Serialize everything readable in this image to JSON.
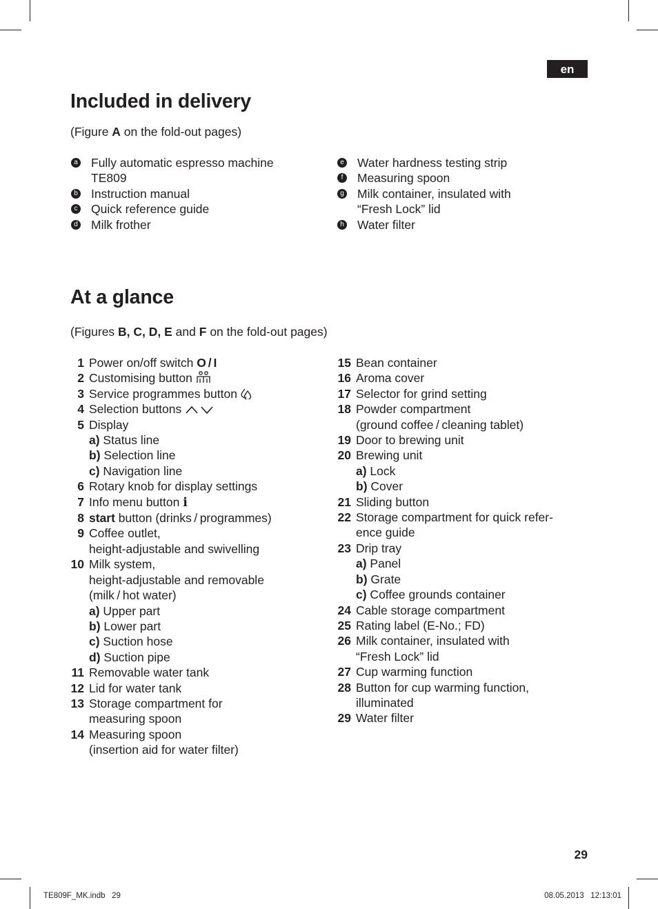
{
  "language_tab": "en",
  "sections": {
    "delivery": {
      "title": "Included in delivery",
      "subtitle_pre": "(Figure ",
      "subtitle_bold": "A",
      "subtitle_post": " on the fold-out pages)",
      "items_left": [
        {
          "marker": "a",
          "lines": [
            "Fully automatic espresso machine",
            "TE809"
          ]
        },
        {
          "marker": "b",
          "lines": [
            "Instruction manual"
          ]
        },
        {
          "marker": "c",
          "lines": [
            "Quick reference guide"
          ]
        },
        {
          "marker": "d",
          "lines": [
            "Milk frother"
          ]
        }
      ],
      "items_right": [
        {
          "marker": "e",
          "lines": [
            "Water hardness testing strip"
          ]
        },
        {
          "marker": "f",
          "lines": [
            "Measuring spoon"
          ]
        },
        {
          "marker": "g",
          "lines": [
            "Milk container, insulated with",
            "“Fresh Lock” lid"
          ]
        },
        {
          "marker": "h",
          "lines": [
            "Water filter"
          ]
        }
      ]
    },
    "glance": {
      "title": "At a glance",
      "subtitle_pre": "(Figures ",
      "subtitle_bold1": "B, C, D, E",
      "subtitle_mid": " and ",
      "subtitle_bold2": "F",
      "subtitle_post": " on the fold-out pages)",
      "items_left": [
        {
          "num": "1",
          "text": "Power on/off switch ",
          "icon": "power-switch-icon",
          "icon_text": "O / I"
        },
        {
          "num": "2",
          "text": "Customising button ",
          "icon": "customising-people-icon"
        },
        {
          "num": "3",
          "text": "Service programmes button ",
          "icon": "service-drops-icon"
        },
        {
          "num": "4",
          "text": "Selection buttons ",
          "icon": "up-down-chevrons-icon"
        },
        {
          "num": "5",
          "text": "Display",
          "subs": [
            {
              "label": "a)",
              "text": " Status line"
            },
            {
              "label": "b)",
              "text": " Selection line"
            },
            {
              "label": "c)",
              "text": " Navigation line"
            }
          ]
        },
        {
          "num": "6",
          "text": "Rotary knob for display settings"
        },
        {
          "num": "7",
          "text": "Info menu button ",
          "icon": "info-icon",
          "icon_text": "i"
        },
        {
          "num": "8",
          "bold_lead": "start",
          "text": " button (drinks / programmes)"
        },
        {
          "num": "9",
          "lines": [
            "Coffee outlet,",
            "height-adjustable and swivelling"
          ]
        },
        {
          "num": "10",
          "lines": [
            "Milk system,",
            "height-adjustable and removable",
            "(milk / hot water)"
          ],
          "subs": [
            {
              "label": "a)",
              "text": " Upper part"
            },
            {
              "label": "b)",
              "text": " Lower part"
            },
            {
              "label": "c)",
              "text": " Suction hose"
            },
            {
              "label": "d)",
              "text": " Suction pipe"
            }
          ]
        },
        {
          "num": "11",
          "text": "Removable water tank"
        },
        {
          "num": "12",
          "text": "Lid for water tank"
        },
        {
          "num": "13",
          "lines": [
            "Storage compartment for",
            "measuring spoon"
          ]
        },
        {
          "num": "14",
          "lines": [
            "Measuring spoon",
            "(insertion aid for water filter)"
          ]
        }
      ],
      "items_right": [
        {
          "num": "15",
          "text": "Bean container"
        },
        {
          "num": "16",
          "text": "Aroma cover"
        },
        {
          "num": "17",
          "text": "Selector for grind setting"
        },
        {
          "num": "18",
          "lines": [
            "Powder compartment",
            "(ground coffee / cleaning tablet)"
          ]
        },
        {
          "num": "19",
          "text": "Door to brewing unit"
        },
        {
          "num": "20",
          "text": "Brewing unit",
          "subs": [
            {
              "label": "a)",
              "text": " Lock"
            },
            {
              "label": "b)",
              "text": " Cover"
            }
          ]
        },
        {
          "num": "21",
          "text": "Sliding button"
        },
        {
          "num": "22",
          "lines": [
            "Storage compartment for quick refer-",
            "ence guide"
          ]
        },
        {
          "num": "23",
          "text": "Drip tray",
          "subs": [
            {
              "label": "a)",
              "text": " Panel"
            },
            {
              "label": "b)",
              "text": " Grate"
            },
            {
              "label": "c)",
              "text": " Coffee grounds container"
            }
          ]
        },
        {
          "num": "24",
          "text": "Cable storage compartment"
        },
        {
          "num": "25",
          "text": "Rating label (E-No.; FD)"
        },
        {
          "num": "26",
          "lines": [
            "Milk container, insulated with",
            "“Fresh Lock” lid"
          ]
        },
        {
          "num": "27",
          "text": "Cup warming function"
        },
        {
          "num": "28",
          "lines": [
            "Button for cup warming function,",
            "illuminated"
          ]
        },
        {
          "num": "29",
          "text": "Water filter"
        }
      ]
    }
  },
  "footer": {
    "page_number": "29",
    "slug_file": "TE809F_MK.indb   29",
    "slug_date": "08.05.2013   12:13:01"
  }
}
